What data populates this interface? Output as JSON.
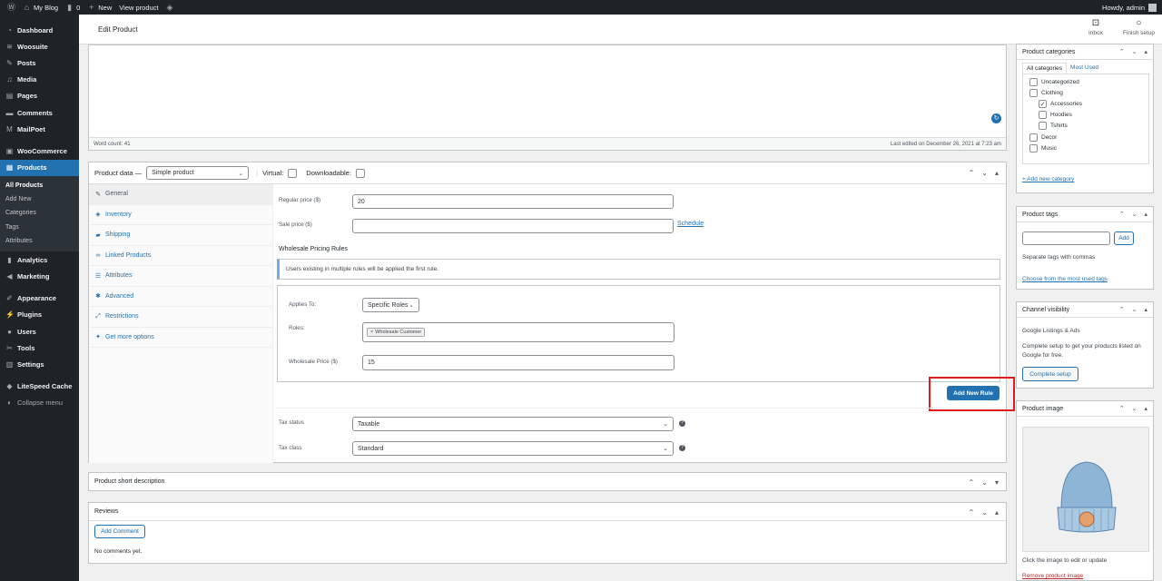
{
  "adminbar": {
    "site_name": "My Blog",
    "comments_count": "0",
    "new_label": "New",
    "view_label": "View product",
    "greeting": "Howdy, admin"
  },
  "sidebar": {
    "items": [
      {
        "label": "Dashboard",
        "icon": "dashboard-icon"
      },
      {
        "label": "Woosuite",
        "icon": "woosuite-icon"
      },
      {
        "label": "Posts",
        "icon": "pin-icon"
      },
      {
        "label": "Media",
        "icon": "media-icon"
      },
      {
        "label": "Pages",
        "icon": "pages-icon"
      },
      {
        "label": "Comments",
        "icon": "comment-icon"
      },
      {
        "label": "MailPoet",
        "icon": "mailpoet-icon"
      },
      {
        "label": "WooCommerce",
        "icon": "woo-icon"
      },
      {
        "label": "Products",
        "icon": "products-icon"
      },
      {
        "label": "Analytics",
        "icon": "analytics-icon"
      },
      {
        "label": "Marketing",
        "icon": "megaphone-icon"
      },
      {
        "label": "Appearance",
        "icon": "brush-icon"
      },
      {
        "label": "Plugins",
        "icon": "plugin-icon"
      },
      {
        "label": "Users",
        "icon": "users-icon"
      },
      {
        "label": "Tools",
        "icon": "wrench-icon"
      },
      {
        "label": "Settings",
        "icon": "settings-icon"
      },
      {
        "label": "LiteSpeed Cache",
        "icon": "diamond-icon"
      },
      {
        "label": "Collapse menu",
        "icon": "collapse-icon"
      }
    ],
    "submenu": [
      "All Products",
      "Add New",
      "Categories",
      "Tags",
      "Attributes"
    ]
  },
  "header": {
    "title": "Edit Product",
    "inbox_label": "Inbox",
    "finish_label": "Finish setup"
  },
  "editor": {
    "word_count": "Word count: 41",
    "last_edited": "Last edited on December 26, 2021 at 7:23 am"
  },
  "product_data": {
    "label": "Product data —",
    "type_value": "Simple product",
    "virtual_label": "Virtual:",
    "downloadable_label": "Downloadable:",
    "tabs": [
      "General",
      "Inventory",
      "Shipping",
      "Linked Products",
      "Attributes",
      "Advanced",
      "Restrictions",
      "Get more options"
    ],
    "regular_price_label": "Regular price ($)",
    "regular_price_value": "20",
    "sale_price_label": "Sale price ($)",
    "sale_price_value": "",
    "schedule_link": "Schedule",
    "wholesale_heading": "Wholesale Pricing Rules",
    "notice": "Users existing in multiple rules will be applied the first rule.",
    "applies_to_label": "Applies To:",
    "applies_to_value": "Specific Roles",
    "roles_label": "Roles:",
    "role_tag": "Wholesale Customer",
    "wholesale_price_label": "Wholesale Price ($)",
    "wholesale_price_value": "15",
    "add_rule_button": "Add New Rule",
    "tax_status_label": "Tax status",
    "tax_status_value": "Taxable",
    "tax_class_label": "Tax class",
    "tax_class_value": "Standard"
  },
  "short_description": {
    "title": "Product short description"
  },
  "reviews": {
    "title": "Reviews",
    "add_comment": "Add Comment",
    "empty": "No comments yet."
  },
  "categories": {
    "title": "Product categories",
    "tab_all": "All categories",
    "tab_most": "Most Used",
    "items": [
      {
        "label": "Uncategorized",
        "checked": false,
        "child": false
      },
      {
        "label": "Clothing",
        "checked": false,
        "child": false
      },
      {
        "label": "Accessories",
        "checked": true,
        "child": true
      },
      {
        "label": "Hoodies",
        "checked": false,
        "child": true
      },
      {
        "label": "Tshirts",
        "checked": false,
        "child": true
      },
      {
        "label": "Decor",
        "checked": false,
        "child": false
      },
      {
        "label": "Music",
        "checked": false,
        "child": false
      }
    ],
    "add_link": "+ Add new category"
  },
  "tags": {
    "title": "Product tags",
    "add_button": "Add",
    "hint": "Separate tags with commas",
    "choose_link": "Choose from the most used tags"
  },
  "channel": {
    "title": "Channel visibility",
    "subtitle": "Google Listings & Ads",
    "text": "Complete setup to get your products listed on Google for free.",
    "button": "Complete setup"
  },
  "product_image": {
    "title": "Product image",
    "hint": "Click the image to edit or update",
    "remove_link": "Remove product image"
  }
}
